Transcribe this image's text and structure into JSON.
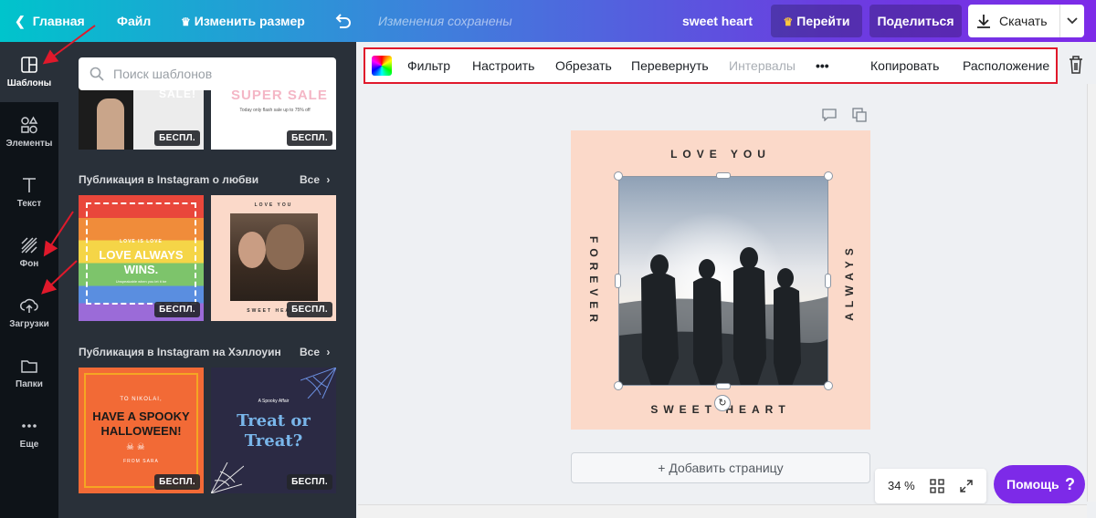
{
  "topbar": {
    "home": "Главная",
    "file": "Файл",
    "resize": "Изменить размер",
    "saved_status": "Изменения сохранены",
    "doc_title": "sweet heart",
    "go": "Перейти",
    "share": "Поделиться",
    "download": "Скачать"
  },
  "sidebar": {
    "tabs": [
      {
        "label": "Шаблоны",
        "icon": "templates-icon"
      },
      {
        "label": "Элементы",
        "icon": "elements-icon"
      },
      {
        "label": "Текст",
        "icon": "text-icon"
      },
      {
        "label": "Фон",
        "icon": "background-icon"
      },
      {
        "label": "Загрузки",
        "icon": "upload-icon"
      },
      {
        "label": "Папки",
        "icon": "folder-icon"
      },
      {
        "label": "Еще",
        "icon": "more-icon"
      }
    ]
  },
  "panel": {
    "search_placeholder": "Поиск шаблонов",
    "free_badge": "БЕСПЛ.",
    "sections": [
      {
        "title": "Публикация в Instagram о любви",
        "all": "Все"
      },
      {
        "title": "Публикация в Instagram на Хэллоуин",
        "all": "Все"
      }
    ],
    "thumbs": {
      "sale1": "SALE!",
      "sale2": "SUPER SALE",
      "sale2_sub": "Today only flash sale up to 75% off",
      "love_small": "LOVE IS LOVE",
      "love_big_1": "LOVE ALWAYS",
      "love_big_2": "WINS.",
      "love_sub": "Unspeakable when you let it be",
      "ly_top": "LOVE YOU",
      "ly_left": "FOREVER",
      "ly_right": "ALWAYS",
      "ly_bottom": "SWEET HEART",
      "hw_to": "TO NIKOLAI,",
      "hw_main_1": "HAVE A SPOOKY",
      "hw_main_2": "HALLOWEEN!",
      "hw_from": "FROM SARA",
      "treat_small": "A Spooky Affair",
      "treat_1": "Treat or",
      "treat_2": "Treat?"
    }
  },
  "toolbar": {
    "filter": "Фильтр",
    "adjust": "Настроить",
    "crop": "Обрезать",
    "flip": "Перевернуть",
    "spacing": "Интервалы",
    "more": "•••",
    "copy": "Копировать",
    "position": "Расположение"
  },
  "design": {
    "top": "LOVE YOU",
    "left": "FOREVER",
    "right": "ALWAYS",
    "bottom": "SWEET HEART",
    "background_color": "#fbd9c9"
  },
  "add_page": "+ Добавить страницу",
  "zoom": "34 %",
  "help": {
    "label": "Помощь",
    "q": "?"
  },
  "colors": {
    "accent": "#7d2ae8",
    "highlight": "#e0192b",
    "sidebar": "#0e1318",
    "panel": "#293039"
  }
}
